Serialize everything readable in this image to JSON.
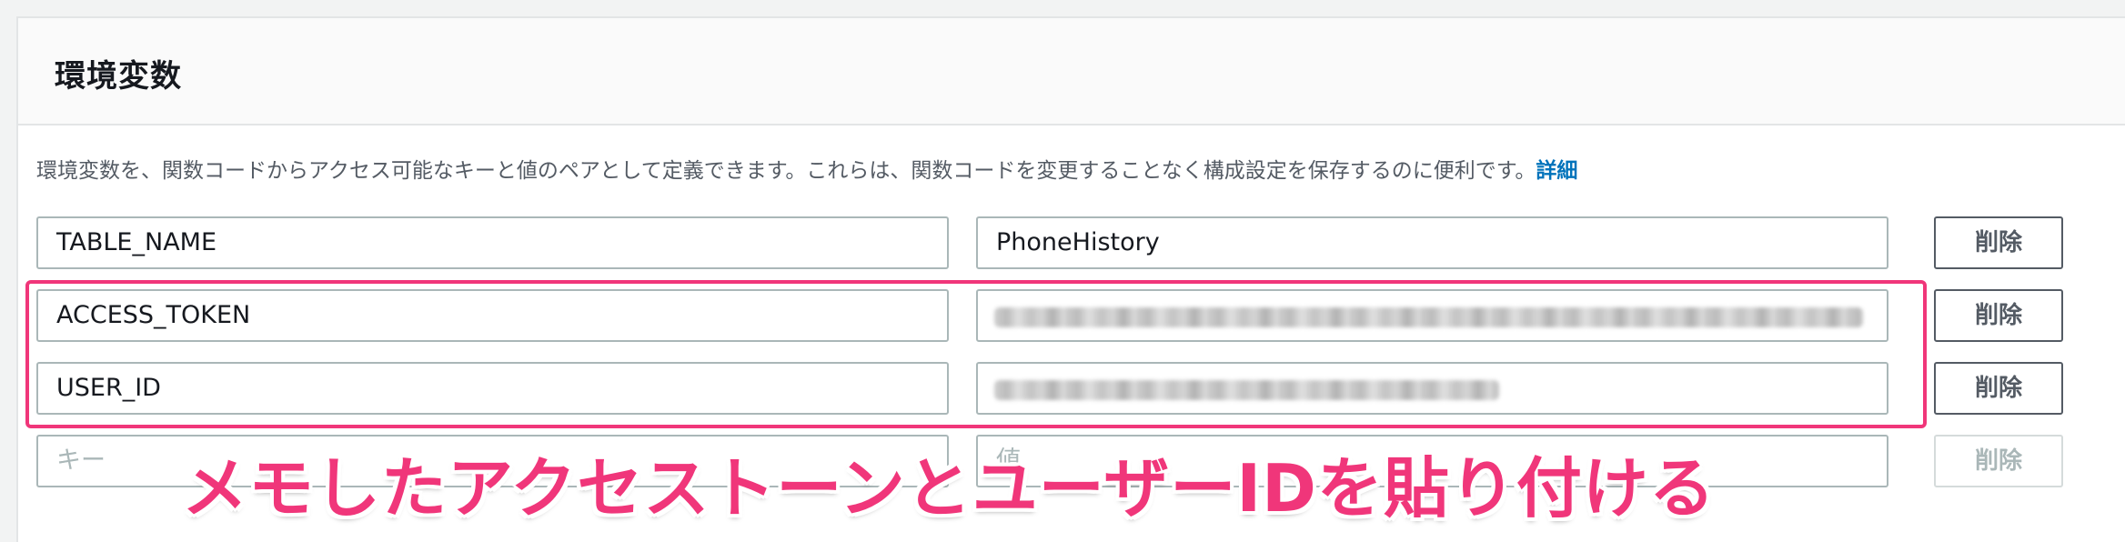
{
  "section": {
    "title": "環境変数",
    "description": "環境変数を、関数コードからアクセス可能なキーと値のペアとして定義できます。これらは、関数コードを変更することなく構成設定を保存するのに便利です。",
    "details_link": "詳細"
  },
  "env_vars": [
    {
      "key": "TABLE_NAME",
      "value": "PhoneHistory",
      "delete_label": "削除"
    },
    {
      "key": "ACCESS_TOKEN",
      "value": "",
      "delete_label": "削除"
    },
    {
      "key": "USER_ID",
      "value": "",
      "delete_label": "削除"
    }
  ],
  "new_row": {
    "key_placeholder": "キー",
    "value_placeholder": "値",
    "delete_label": "削除"
  },
  "annotation": {
    "text": "メモしたアクセストーンとユーザーIDを貼り付ける",
    "color": "#f0367a"
  },
  "colors": {
    "link": "#0073bb",
    "highlight": "#f0367a"
  }
}
